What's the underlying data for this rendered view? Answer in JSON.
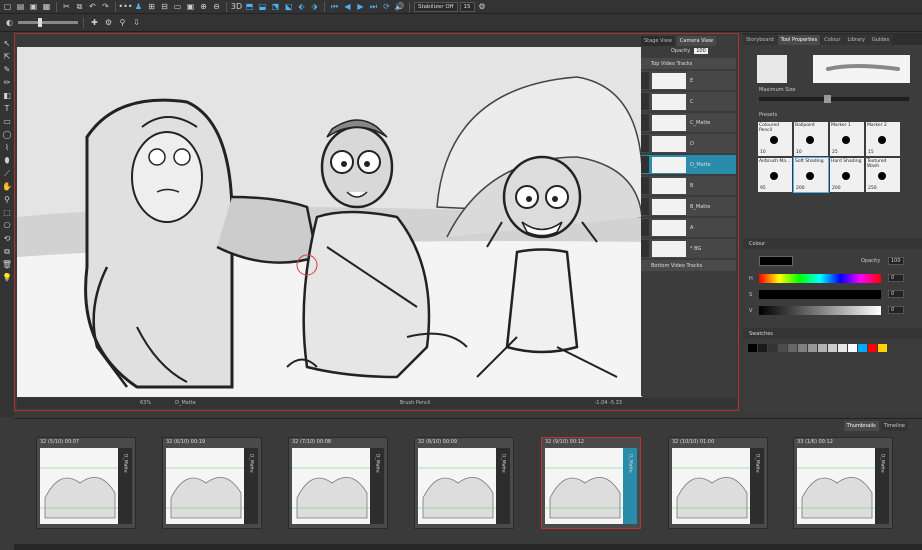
{
  "toolbar": {
    "stabilizer_label": "Stabilizer Off",
    "zoom_value": "15"
  },
  "stage": {
    "tabs": [
      "Stage View",
      "Camera View"
    ],
    "opacity_label": "Opacity",
    "opacity_value": "100",
    "status_zoom": "63%",
    "status_panel": "D_Matte",
    "status_tool": "Brush Pencil",
    "status_coords": "-1.04 -5.33"
  },
  "tracks": {
    "top_label": "Top Video Tracks",
    "bottom_label": "Bottom Video Tracks",
    "items": [
      {
        "name": "E"
      },
      {
        "name": "C"
      },
      {
        "name": "C_Matte"
      },
      {
        "name": "D"
      },
      {
        "name": "D_Matte",
        "selected": true
      },
      {
        "name": "B"
      },
      {
        "name": "B_Matte"
      },
      {
        "name": "A"
      },
      {
        "name": "* BG"
      }
    ]
  },
  "right_panel": {
    "tabs": [
      "Storyboard",
      "Tool Properties",
      "Colour",
      "Library",
      "Guides"
    ],
    "active_tab": "Tool Properties",
    "max_size_label": "Maximum Size",
    "presets_label": "Presets",
    "presets": [
      {
        "name": "Coloured Pencil",
        "size": "10"
      },
      {
        "name": "Ballpoint",
        "size": "10"
      },
      {
        "name": "Marker 1",
        "size": "25"
      },
      {
        "name": "Marker 2",
        "size": "15"
      },
      {
        "name": "Airbrush Ma...",
        "size": "95"
      },
      {
        "name": "Soft Shading",
        "size": "200",
        "selected": true
      },
      {
        "name": "Hard Shading",
        "size": "200"
      },
      {
        "name": "Textured Wash",
        "size": "250"
      }
    ],
    "colour_label": "Colour",
    "opacity_label": "Opacity",
    "opacity_value": "100",
    "h_label": "H",
    "h_value": "0",
    "s_label": "S",
    "s_value": "0",
    "v_label": "V",
    "v_value": "0",
    "swatches_label": "Swatches",
    "swatch_colors": [
      "#000000",
      "#1a1a1a",
      "#333333",
      "#4d4d4d",
      "#666666",
      "#808080",
      "#999999",
      "#b3b3b3",
      "#cccccc",
      "#e6e6e6",
      "#ffffff",
      "#00aaff",
      "#ff0000",
      "#ffd400"
    ]
  },
  "thumbnails": {
    "tabs": [
      "Thumbnails",
      "Timeline"
    ],
    "active_tab": "Thumbnails",
    "panels": [
      {
        "label": "32 (5/10) 00:07",
        "side": "D_Matte"
      },
      {
        "label": "32 (6/10) 00:19",
        "side": "D_Matte"
      },
      {
        "label": "32 (7/10) 00:08",
        "side": "D_Matte"
      },
      {
        "label": "32 (8/10) 00:09",
        "side": "D_Matte"
      },
      {
        "label": "32 (9/10) 00:12",
        "side": "D_Matte",
        "active": true
      },
      {
        "label": "32 (10/10) 01:00",
        "side": "D_Matte"
      },
      {
        "label": "33 (1/6) 00:12",
        "side": "D_Matte"
      }
    ]
  }
}
